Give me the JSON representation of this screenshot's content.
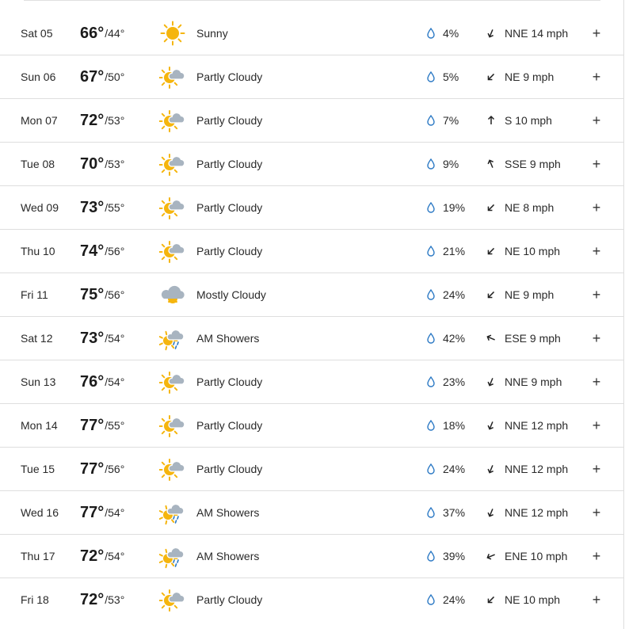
{
  "forecast": {
    "days": [
      {
        "day": "Sat 05",
        "hi": "66°",
        "lo": "44°",
        "icon": "sunny-icon",
        "phrase": "Sunny",
        "precip": "4%",
        "wind": "NNE 14 mph",
        "wind_dir": "NNE"
      },
      {
        "day": "Sun 06",
        "hi": "67°",
        "lo": "50°",
        "icon": "partly-cloudy-icon",
        "phrase": "Partly Cloudy",
        "precip": "5%",
        "wind": "NE 9 mph",
        "wind_dir": "NE"
      },
      {
        "day": "Mon 07",
        "hi": "72°",
        "lo": "53°",
        "icon": "partly-cloudy-icon",
        "phrase": "Partly Cloudy",
        "precip": "7%",
        "wind": "S 10 mph",
        "wind_dir": "S"
      },
      {
        "day": "Tue 08",
        "hi": "70°",
        "lo": "53°",
        "icon": "partly-cloudy-icon",
        "phrase": "Partly Cloudy",
        "precip": "9%",
        "wind": "SSE 9 mph",
        "wind_dir": "SSE"
      },
      {
        "day": "Wed 09",
        "hi": "73°",
        "lo": "55°",
        "icon": "partly-cloudy-icon",
        "phrase": "Partly Cloudy",
        "precip": "19%",
        "wind": "NE 8 mph",
        "wind_dir": "NE"
      },
      {
        "day": "Thu 10",
        "hi": "74°",
        "lo": "56°",
        "icon": "partly-cloudy-icon",
        "phrase": "Partly Cloudy",
        "precip": "21%",
        "wind": "NE 10 mph",
        "wind_dir": "NE"
      },
      {
        "day": "Fri 11",
        "hi": "75°",
        "lo": "56°",
        "icon": "mostly-cloudy-icon",
        "phrase": "Mostly Cloudy",
        "precip": "24%",
        "wind": "NE 9 mph",
        "wind_dir": "NE"
      },
      {
        "day": "Sat 12",
        "hi": "73°",
        "lo": "54°",
        "icon": "am-showers-icon",
        "phrase": "AM Showers",
        "precip": "42%",
        "wind": "ESE 9 mph",
        "wind_dir": "ESE"
      },
      {
        "day": "Sun 13",
        "hi": "76°",
        "lo": "54°",
        "icon": "partly-cloudy-icon",
        "phrase": "Partly Cloudy",
        "precip": "23%",
        "wind": "NNE 9 mph",
        "wind_dir": "NNE"
      },
      {
        "day": "Mon 14",
        "hi": "77°",
        "lo": "55°",
        "icon": "partly-cloudy-icon",
        "phrase": "Partly Cloudy",
        "precip": "18%",
        "wind": "NNE 12 mph",
        "wind_dir": "NNE"
      },
      {
        "day": "Tue 15",
        "hi": "77°",
        "lo": "56°",
        "icon": "partly-cloudy-icon",
        "phrase": "Partly Cloudy",
        "precip": "24%",
        "wind": "NNE 12 mph",
        "wind_dir": "NNE"
      },
      {
        "day": "Wed 16",
        "hi": "77°",
        "lo": "54°",
        "icon": "am-showers-icon",
        "phrase": "AM Showers",
        "precip": "37%",
        "wind": "NNE 12 mph",
        "wind_dir": "NNE"
      },
      {
        "day": "Thu 17",
        "hi": "72°",
        "lo": "54°",
        "icon": "am-showers-icon",
        "phrase": "AM Showers",
        "precip": "39%",
        "wind": "ENE 10 mph",
        "wind_dir": "ENE"
      },
      {
        "day": "Fri 18",
        "hi": "72°",
        "lo": "53°",
        "icon": "partly-cloudy-icon",
        "phrase": "Partly Cloudy",
        "precip": "24%",
        "wind": "NE 10 mph",
        "wind_dir": "NE"
      }
    ],
    "separator": "/",
    "expand_label": "+"
  },
  "colors": {
    "sun": "#f5b50e",
    "cloud": "#a8b4c0",
    "rain": "#2a78c4",
    "drop": "#2a78c4"
  }
}
